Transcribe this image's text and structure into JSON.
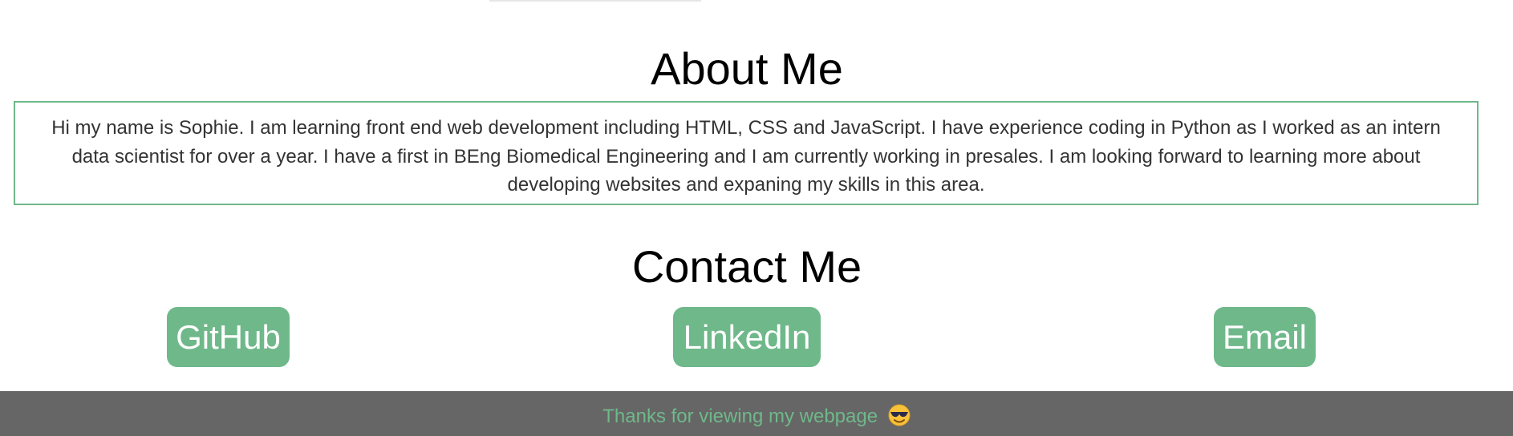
{
  "about": {
    "title": "About Me",
    "text": "Hi my name is Sophie. I am learning front end web development including HTML, CSS and JavaScript. I have experience coding in Python as I worked as an intern data scientist for over a year. I have a first in BEng Biomedical Engineering and I am currently working in presales. I am looking forward to learning more about developing websites and expaning my skills in this area."
  },
  "contact": {
    "title": "Contact Me",
    "github_label": "GitHub",
    "linkedin_label": "LinkedIn",
    "email_label": "Email"
  },
  "footer": {
    "text": "Thanks for viewing my webpage",
    "emoji_icon": "sunglasses-face-icon"
  },
  "colors": {
    "accent": "#6fb88a",
    "footer_bg": "#666666"
  }
}
